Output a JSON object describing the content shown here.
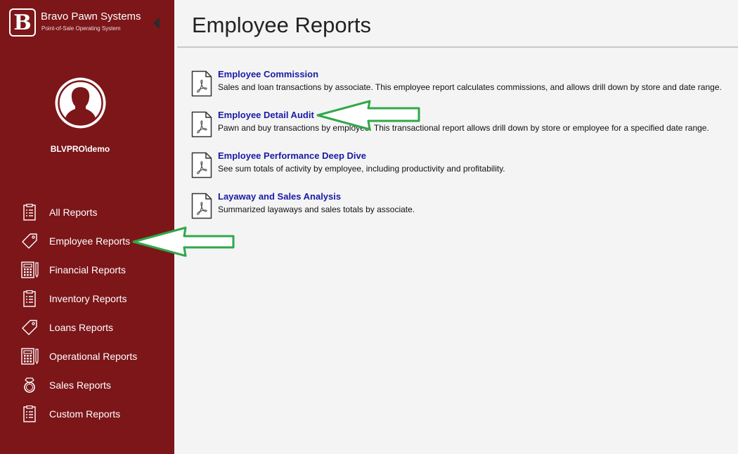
{
  "brand": {
    "logo_letter": "B",
    "name": "Bravo Pawn Systems",
    "tagline": "Point-of-Sale Operating System"
  },
  "user": {
    "name": "BLVPRO\\demo"
  },
  "nav": {
    "items": [
      {
        "label": "All Reports",
        "icon": "clipboard-icon"
      },
      {
        "label": "Employee Reports",
        "icon": "tag-icon"
      },
      {
        "label": "Financial Reports",
        "icon": "calculator-icon"
      },
      {
        "label": "Inventory Reports",
        "icon": "clipboard-icon"
      },
      {
        "label": "Loans Reports",
        "icon": "tag-icon"
      },
      {
        "label": "Operational Reports",
        "icon": "calculator-icon"
      },
      {
        "label": "Sales Reports",
        "icon": "ring-icon"
      },
      {
        "label": "Custom Reports",
        "icon": "clipboard-icon"
      }
    ]
  },
  "page": {
    "title": "Employee Reports"
  },
  "reports": [
    {
      "title": "Employee Commission",
      "description": "Sales and loan transactions by associate. This employee report calculates commissions, and allows drill down by store and date range.",
      "icon": "pdf-file-icon"
    },
    {
      "title": "Employee Detail Audit",
      "description": "Pawn and buy transactions by employee. This transactional report allows drill down by store or employee for a specified date range.",
      "icon": "pdf-file-icon"
    },
    {
      "title": "Employee Performance Deep Dive",
      "description": "See sum totals of activity by employee, including productivity and profitability.",
      "icon": "pdf-file-icon"
    },
    {
      "title": "Layaway and Sales Analysis",
      "description": "Summarized layaways and sales totals by associate.",
      "icon": "pdf-file-icon"
    }
  ],
  "colors": {
    "sidebar_bg": "#7c1619",
    "link": "#1a1aa6",
    "annotation_arrow": "#2fa84a"
  }
}
